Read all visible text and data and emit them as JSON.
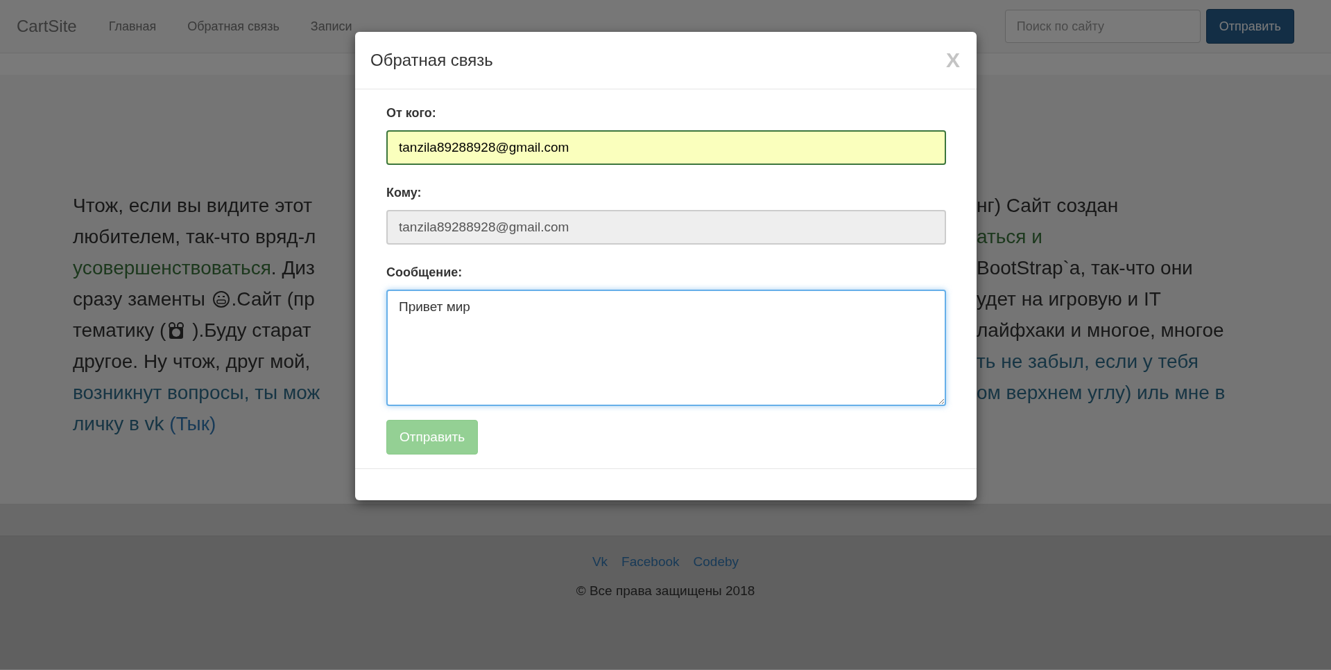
{
  "navbar": {
    "brand": "CartSite",
    "links": [
      "Главная",
      "Обратная связь",
      "Записи"
    ],
    "search": {
      "placeholder": "Поиск по сайту"
    },
    "button": "Отправить"
  },
  "article": {
    "lines": [
      {
        "left": [
          {
            "kind": "text",
            "text": "Чтож, если вы видите этот"
          }
        ],
        "right": [
          {
            "kind": "text",
            "text": "нг) Сайт создан"
          }
        ]
      },
      {
        "left": [
          {
            "kind": "text",
            "text": "любителем, так-что вряд-л"
          }
        ],
        "right": [
          {
            "kind": "success",
            "text": "аться и"
          }
        ]
      },
      {
        "left": [
          {
            "kind": "success",
            "text": "усовершенствоваться"
          },
          {
            "kind": "text",
            "text": ". Диз"
          }
        ],
        "right": [
          {
            "kind": "text",
            "text": "BootStrap`a, так-что они"
          }
        ]
      },
      {
        "left": [
          {
            "kind": "text",
            "text": "сразу заменты "
          },
          {
            "kind": "grin"
          },
          {
            "kind": "text",
            "text": ".Сайт (пр"
          }
        ],
        "right": [
          {
            "kind": "text",
            "text": "удет на игровую и IT"
          }
        ]
      },
      {
        "left": [
          {
            "kind": "text",
            "text": "тематику ("
          },
          {
            "kind": "hands"
          },
          {
            "kind": "text",
            "text": " ).Буду старат"
          }
        ],
        "right": [
          {
            "kind": "text",
            "text": "лайфхаки и многое, многое"
          }
        ]
      },
      {
        "left": [
          {
            "kind": "text",
            "text": "другое. Ну чтож, друг мой,"
          }
        ],
        "right": [
          {
            "kind": "info",
            "text": "ть не забыл, если у тебя"
          }
        ]
      },
      {
        "left": [
          {
            "kind": "info",
            "text": "возникнут вопросы, ты мож"
          }
        ],
        "right": [
          {
            "kind": "info",
            "text": "ом верхнем углу) иль мне в"
          }
        ]
      },
      {
        "left": [
          {
            "kind": "info",
            "text": "личку в vk "
          },
          {
            "kind": "link",
            "text": "(Тык)"
          }
        ]
      }
    ]
  },
  "modal": {
    "title": "Обратная связь",
    "close": "X",
    "fields": [
      {
        "kind": "input",
        "label": "От кого:",
        "value": "tanzila89288928@gmail.com",
        "autofilled": true,
        "disabled": false,
        "focused": false
      },
      {
        "kind": "input",
        "label": "Кому:",
        "value": "tanzila89288928@gmail.com",
        "autofilled": false,
        "disabled": true,
        "focused": false
      },
      {
        "kind": "textarea",
        "label": "Сообщение:",
        "value": "Привет мир",
        "autofilled": false,
        "disabled": false,
        "focused": true
      }
    ],
    "submit": {
      "label": "Отправить",
      "disabled": true
    }
  },
  "footer": {
    "links": [
      "Vk",
      "Facebook",
      "Codeby"
    ],
    "copyright": "© Все права защищены 2018"
  }
}
